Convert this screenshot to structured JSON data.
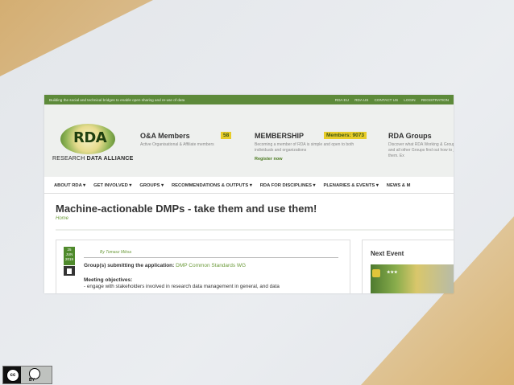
{
  "topbar": {
    "tagline": "Building the social and technical bridges to enable open sharing and re-use of data",
    "links": [
      "RDA EU",
      "RDA US",
      "CONTACT US",
      "LOGIN",
      "REGISTRATION"
    ]
  },
  "logo": {
    "wordmark": "RDA",
    "subtitle_part1": "RESEARCH ",
    "subtitle_part2": "DATA ALLIANCE"
  },
  "header": {
    "oa": {
      "title": "O&A Members",
      "count": "58",
      "desc": "Active Organisational & Affiliate members"
    },
    "membership": {
      "title": "MEMBERSHIP",
      "badge": "Members: 9073",
      "desc": "Becoming a member of RDA is simple and open to both individuals and organizations",
      "register": "Register now"
    },
    "groups": {
      "title": "RDA Groups",
      "desc": "Discover what RDA Working & Groups and all other Groups find out how to join them. Ex"
    }
  },
  "nav": [
    "ABOUT RDA ▾",
    "GET INVOLVED ▾",
    "GROUPS ▾",
    "RECOMMENDATIONS & OUTPUTS ▾",
    "RDA FOR DISCIPLINES ▾",
    "PLENARIES & EVENTS ▾",
    "NEWS & M"
  ],
  "page": {
    "title": "Machine-actionable DMPs - take them and use them!",
    "breadcrumb": "Home"
  },
  "post": {
    "date_day": "25",
    "date_month": "JUN",
    "date_year": "2019",
    "author": "By Tomasz Miksa",
    "groups_label": "Group(s) submitting the application:",
    "groups_link": "DMP Common Standards WG",
    "objectives_label": "Meeting objectives:",
    "objectives_text": "- engage with stakeholders involved in research data management in general, and data"
  },
  "sidebar": {
    "next_event": "Next Event"
  },
  "license": {
    "cc": "cc",
    "by": "BY"
  },
  "colors": {
    "green": "#5d8a3a",
    "gold": "#d4ae72",
    "accent_yellow": "#e7cc2a"
  }
}
